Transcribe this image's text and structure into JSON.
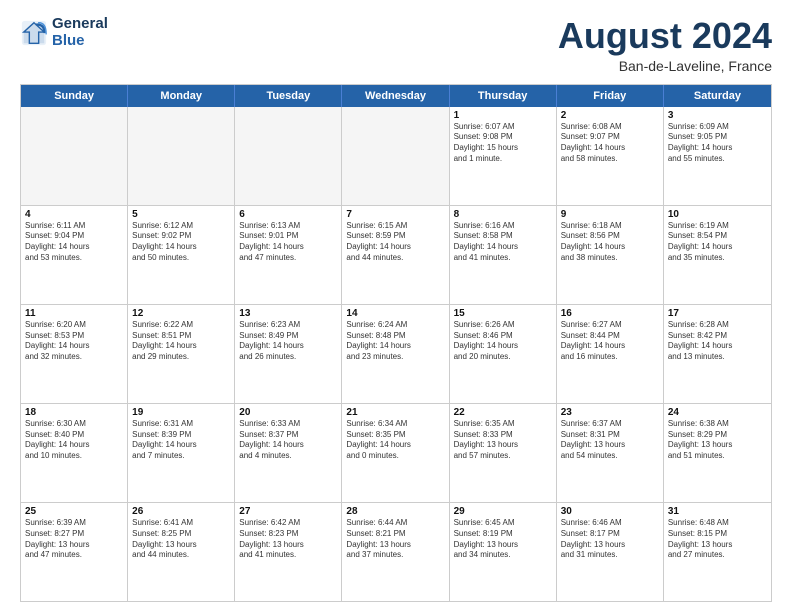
{
  "logo": {
    "line1": "General",
    "line2": "Blue"
  },
  "title": "August 2024",
  "subtitle": "Ban-de-Laveline, France",
  "header_days": [
    "Sunday",
    "Monday",
    "Tuesday",
    "Wednesday",
    "Thursday",
    "Friday",
    "Saturday"
  ],
  "weeks": [
    [
      {
        "day": "",
        "text": "",
        "empty": true
      },
      {
        "day": "",
        "text": "",
        "empty": true
      },
      {
        "day": "",
        "text": "",
        "empty": true
      },
      {
        "day": "",
        "text": "",
        "empty": true
      },
      {
        "day": "1",
        "text": "Sunrise: 6:07 AM\nSunset: 9:08 PM\nDaylight: 15 hours\nand 1 minute.",
        "empty": false
      },
      {
        "day": "2",
        "text": "Sunrise: 6:08 AM\nSunset: 9:07 PM\nDaylight: 14 hours\nand 58 minutes.",
        "empty": false
      },
      {
        "day": "3",
        "text": "Sunrise: 6:09 AM\nSunset: 9:05 PM\nDaylight: 14 hours\nand 55 minutes.",
        "empty": false
      }
    ],
    [
      {
        "day": "4",
        "text": "Sunrise: 6:11 AM\nSunset: 9:04 PM\nDaylight: 14 hours\nand 53 minutes.",
        "empty": false
      },
      {
        "day": "5",
        "text": "Sunrise: 6:12 AM\nSunset: 9:02 PM\nDaylight: 14 hours\nand 50 minutes.",
        "empty": false
      },
      {
        "day": "6",
        "text": "Sunrise: 6:13 AM\nSunset: 9:01 PM\nDaylight: 14 hours\nand 47 minutes.",
        "empty": false
      },
      {
        "day": "7",
        "text": "Sunrise: 6:15 AM\nSunset: 8:59 PM\nDaylight: 14 hours\nand 44 minutes.",
        "empty": false
      },
      {
        "day": "8",
        "text": "Sunrise: 6:16 AM\nSunset: 8:58 PM\nDaylight: 14 hours\nand 41 minutes.",
        "empty": false
      },
      {
        "day": "9",
        "text": "Sunrise: 6:18 AM\nSunset: 8:56 PM\nDaylight: 14 hours\nand 38 minutes.",
        "empty": false
      },
      {
        "day": "10",
        "text": "Sunrise: 6:19 AM\nSunset: 8:54 PM\nDaylight: 14 hours\nand 35 minutes.",
        "empty": false
      }
    ],
    [
      {
        "day": "11",
        "text": "Sunrise: 6:20 AM\nSunset: 8:53 PM\nDaylight: 14 hours\nand 32 minutes.",
        "empty": false
      },
      {
        "day": "12",
        "text": "Sunrise: 6:22 AM\nSunset: 8:51 PM\nDaylight: 14 hours\nand 29 minutes.",
        "empty": false
      },
      {
        "day": "13",
        "text": "Sunrise: 6:23 AM\nSunset: 8:49 PM\nDaylight: 14 hours\nand 26 minutes.",
        "empty": false
      },
      {
        "day": "14",
        "text": "Sunrise: 6:24 AM\nSunset: 8:48 PM\nDaylight: 14 hours\nand 23 minutes.",
        "empty": false
      },
      {
        "day": "15",
        "text": "Sunrise: 6:26 AM\nSunset: 8:46 PM\nDaylight: 14 hours\nand 20 minutes.",
        "empty": false
      },
      {
        "day": "16",
        "text": "Sunrise: 6:27 AM\nSunset: 8:44 PM\nDaylight: 14 hours\nand 16 minutes.",
        "empty": false
      },
      {
        "day": "17",
        "text": "Sunrise: 6:28 AM\nSunset: 8:42 PM\nDaylight: 14 hours\nand 13 minutes.",
        "empty": false
      }
    ],
    [
      {
        "day": "18",
        "text": "Sunrise: 6:30 AM\nSunset: 8:40 PM\nDaylight: 14 hours\nand 10 minutes.",
        "empty": false
      },
      {
        "day": "19",
        "text": "Sunrise: 6:31 AM\nSunset: 8:39 PM\nDaylight: 14 hours\nand 7 minutes.",
        "empty": false
      },
      {
        "day": "20",
        "text": "Sunrise: 6:33 AM\nSunset: 8:37 PM\nDaylight: 14 hours\nand 4 minutes.",
        "empty": false
      },
      {
        "day": "21",
        "text": "Sunrise: 6:34 AM\nSunset: 8:35 PM\nDaylight: 14 hours\nand 0 minutes.",
        "empty": false
      },
      {
        "day": "22",
        "text": "Sunrise: 6:35 AM\nSunset: 8:33 PM\nDaylight: 13 hours\nand 57 minutes.",
        "empty": false
      },
      {
        "day": "23",
        "text": "Sunrise: 6:37 AM\nSunset: 8:31 PM\nDaylight: 13 hours\nand 54 minutes.",
        "empty": false
      },
      {
        "day": "24",
        "text": "Sunrise: 6:38 AM\nSunset: 8:29 PM\nDaylight: 13 hours\nand 51 minutes.",
        "empty": false
      }
    ],
    [
      {
        "day": "25",
        "text": "Sunrise: 6:39 AM\nSunset: 8:27 PM\nDaylight: 13 hours\nand 47 minutes.",
        "empty": false
      },
      {
        "day": "26",
        "text": "Sunrise: 6:41 AM\nSunset: 8:25 PM\nDaylight: 13 hours\nand 44 minutes.",
        "empty": false
      },
      {
        "day": "27",
        "text": "Sunrise: 6:42 AM\nSunset: 8:23 PM\nDaylight: 13 hours\nand 41 minutes.",
        "empty": false
      },
      {
        "day": "28",
        "text": "Sunrise: 6:44 AM\nSunset: 8:21 PM\nDaylight: 13 hours\nand 37 minutes.",
        "empty": false
      },
      {
        "day": "29",
        "text": "Sunrise: 6:45 AM\nSunset: 8:19 PM\nDaylight: 13 hours\nand 34 minutes.",
        "empty": false
      },
      {
        "day": "30",
        "text": "Sunrise: 6:46 AM\nSunset: 8:17 PM\nDaylight: 13 hours\nand 31 minutes.",
        "empty": false
      },
      {
        "day": "31",
        "text": "Sunrise: 6:48 AM\nSunset: 8:15 PM\nDaylight: 13 hours\nand 27 minutes.",
        "empty": false
      }
    ]
  ]
}
